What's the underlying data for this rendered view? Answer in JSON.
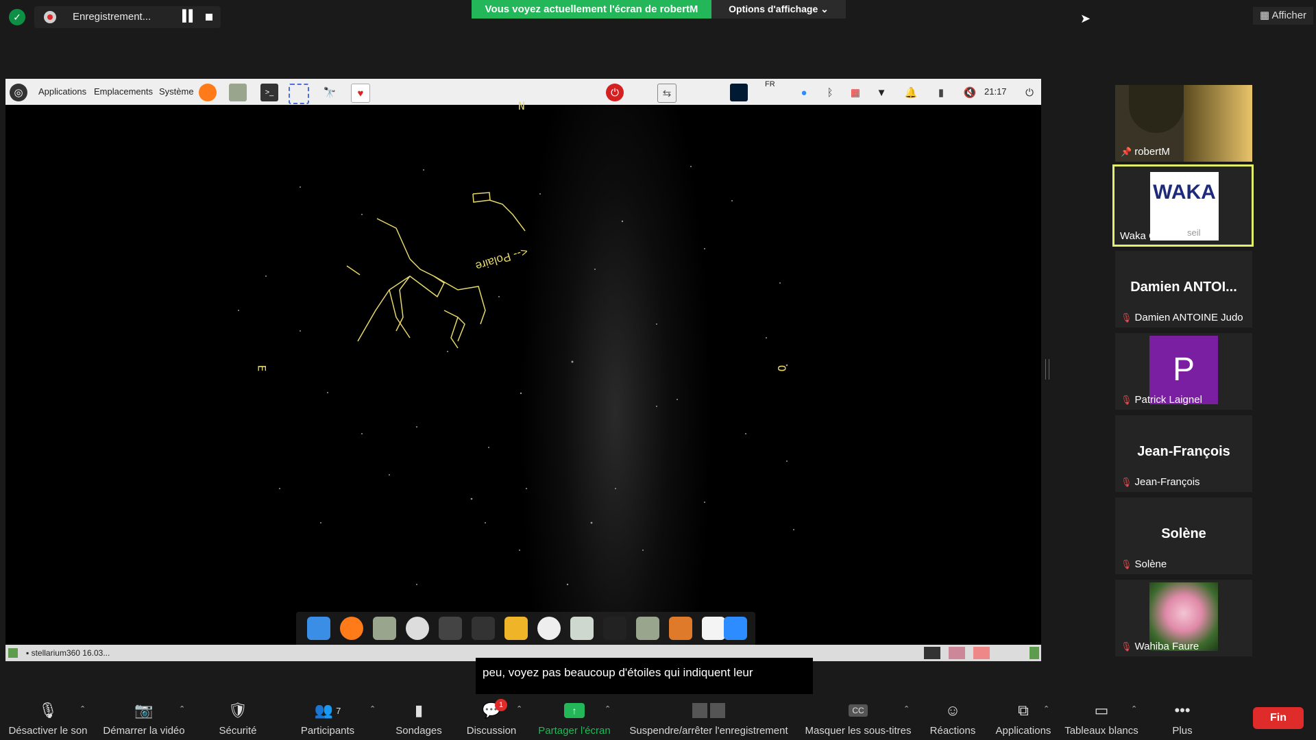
{
  "topbar": {
    "recording_label": "Enregistrement...",
    "share_banner": "Vous voyez actuellement l'écran de robertM",
    "view_options": "Options d'affichage",
    "afficher": "Afficher"
  },
  "shared_screen": {
    "panel_menu": [
      "Applications",
      "Emplacements",
      "Système"
    ],
    "lang_indicator": "FR",
    "clock": "21:17",
    "taskbar_window": "stellarium360 16.03...",
    "sky_labels": {
      "north": "N",
      "east": "E",
      "west": "O",
      "polaris": "<-- Polaire"
    }
  },
  "caption": "peu, voyez pas beaucoup d'étoiles qui indiquent leur",
  "participants": [
    {
      "name": "robertM",
      "kind": "video",
      "muted": false
    },
    {
      "name": "Waka Conseil",
      "kind": "logo",
      "logo_text": "WAKA",
      "logo_sub": "seil",
      "active": true
    },
    {
      "name": "Damien ANTOINE Judo",
      "big": "Damien  ANTOI...",
      "muted": true
    },
    {
      "name": "Patrick Laignel",
      "avatar_letter": "P",
      "avatar_color": "#7b1fa2",
      "muted": true
    },
    {
      "name": "Jean-François",
      "big": "Jean-François",
      "muted": true
    },
    {
      "name": "Solène",
      "big": "Solène",
      "muted": true
    },
    {
      "name": "Wahiba Faure",
      "kind": "photo",
      "muted": true
    }
  ],
  "toolbar": {
    "mute": "Désactiver le son",
    "video": "Démarrer la vidéo",
    "security": "Sécurité",
    "participants": "Participants",
    "participants_count": "7",
    "polls": "Sondages",
    "chat": "Discussion",
    "chat_badge": "1",
    "share": "Partager l'écran",
    "recording": "Suspendre/arrêter l'enregistrement",
    "captions": "Masquer les sous-titres",
    "reactions": "Réactions",
    "apps": "Applications",
    "whiteboards": "Tableaux blancs",
    "more": "Plus",
    "end": "Fin"
  },
  "colors": {
    "share_green": "#23b75a",
    "end_red": "#e02b2b",
    "constellation": "#e7d96b"
  }
}
